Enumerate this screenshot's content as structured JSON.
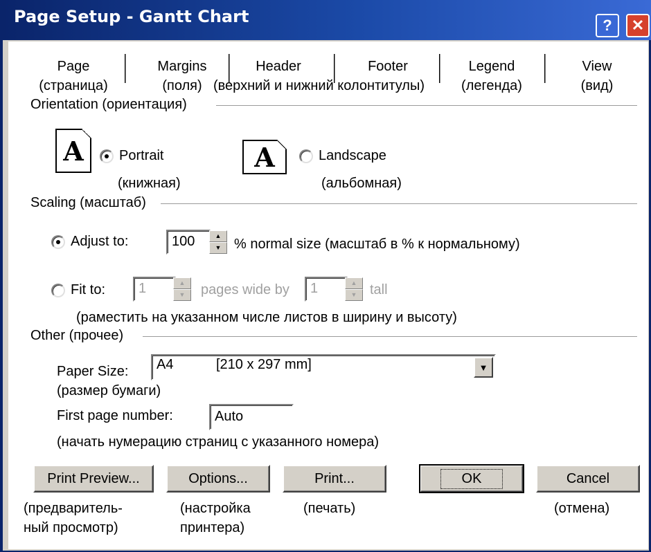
{
  "window": {
    "title": "Page Setup - Gantt Chart",
    "help_icon": "?",
    "close_icon": "✕"
  },
  "tabs": [
    {
      "en": "Page",
      "ru": "(страница)"
    },
    {
      "en": "Margins",
      "ru": "(поля)"
    },
    {
      "en": "Header",
      "ru": "(верхний и нижний колонтитулы)"
    },
    {
      "en": "Footer",
      "ru": ""
    },
    {
      "en": "Legend",
      "ru": "(легенда)"
    },
    {
      "en": "View",
      "ru": "(вид)"
    }
  ],
  "orientation": {
    "group_label": "Orientation (ориентация)",
    "portrait_label": "Portrait",
    "portrait_ru": "(книжная)",
    "landscape_label": "Landscape",
    "landscape_ru": "(альбомная)",
    "selected": "portrait",
    "icon_letter": "A"
  },
  "scaling": {
    "group_label": "Scaling (масштаб)",
    "adjust_label": "Adjust to:",
    "adjust_value": "100",
    "adjust_suffix": "% normal size (масштаб в % к нормальному)",
    "fit_label": "Fit to:",
    "fit_wide_value": "1",
    "fit_wide_label": "pages wide by",
    "fit_tall_value": "1",
    "fit_tall_label": "tall",
    "fit_note": "(раместить на указанном числе листов в ширину и высоту)",
    "selected": "adjust"
  },
  "other": {
    "group_label": "Other (прочее)",
    "paper_size_label": "Paper Size:",
    "paper_size_ru": "(размер бумаги)",
    "paper_size_value": "A4",
    "paper_size_dims": "[210 x 297 mm]",
    "first_page_label": "First page number:",
    "first_page_value": "Auto",
    "first_page_note": "(начать нумерацию страниц с указанного номера)"
  },
  "buttons": {
    "print_preview": "Print Preview...",
    "print_preview_ru_1": "(предваритель-",
    "print_preview_ru_2": "ный просмотр)",
    "options": "Options...",
    "options_ru_1": "(настройка",
    "options_ru_2": "принтера)",
    "print": "Print...",
    "print_ru": "(печать)",
    "ok": "OK",
    "cancel": "Cancel",
    "cancel_ru": "(отмена)"
  }
}
